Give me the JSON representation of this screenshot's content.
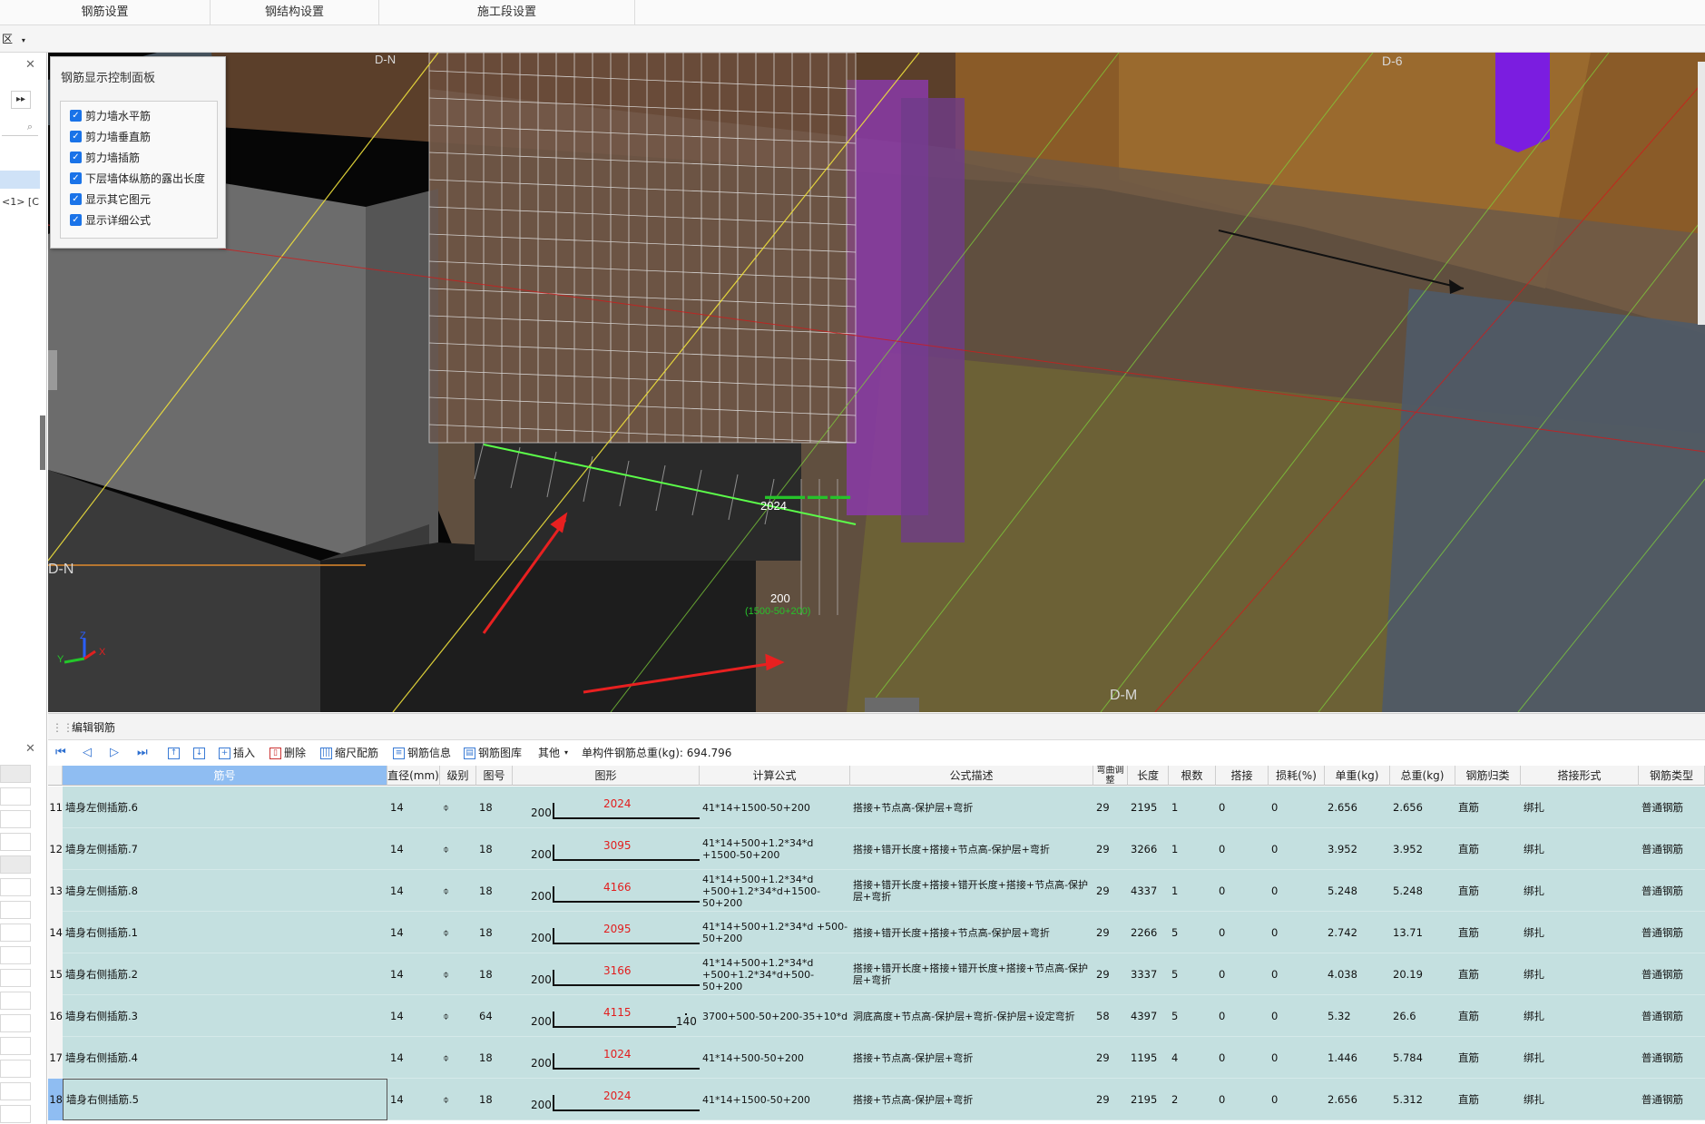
{
  "top_tabs": [
    "钢筋设置",
    "钢结构设置",
    "施工段设置"
  ],
  "region_select": "区",
  "left_panel": {
    "text_1": "<1> [C"
  },
  "control_panel": {
    "title": "钢筋显示控制面板",
    "items": [
      {
        "label": "剪力墙水平筋",
        "checked": true
      },
      {
        "label": "剪力墙垂直筋",
        "checked": true
      },
      {
        "label": "剪力墙插筋",
        "checked": true
      },
      {
        "label": "下层墙体纵筋的露出长度",
        "checked": true
      },
      {
        "label": "显示其它图元",
        "checked": true
      },
      {
        "label": "显示详细公式",
        "checked": true
      }
    ]
  },
  "viewport": {
    "axis_labels": [
      "D-N",
      "D-M",
      "D-6",
      "D-N"
    ],
    "dim_labels": [
      "2024",
      "200"
    ],
    "dim_sub_labels": [
      "(1500-50+200)"
    ],
    "axis_triad": {
      "x": "X",
      "y": "Y",
      "z": "Z"
    },
    "arrow_color": "#e82020"
  },
  "edit_panel": {
    "title": "编辑钢筋",
    "toolbar": {
      "insert": "插入",
      "delete": "删除",
      "scale_rebar": "缩尺配筋",
      "rebar_info": "钢筋信息",
      "rebar_library": "钢筋图库",
      "other": "其他",
      "total_weight": "单构件钢筋总重(kg): 694.796"
    },
    "columns": [
      "筋号",
      "直径(mm)",
      "级别",
      "图号",
      "图形",
      "计算公式",
      "公式描述",
      "弯曲调整",
      "长度",
      "根数",
      "搭接",
      "损耗(%)",
      "单重(kg)",
      "总重(kg)",
      "钢筋归类",
      "搭接形式",
      "钢筋类型"
    ],
    "rows": [
      {
        "num": "11",
        "name": "墙身左侧插筋.6",
        "dia": "14",
        "grade": "⌽",
        "fig": "18",
        "shape_left": "200",
        "shape_value": "2024",
        "shape_right": "",
        "formula": "41*14+1500-50+200",
        "desc": "搭接+节点高-保护层+弯折",
        "bend": "29",
        "length": "2195",
        "count": "1",
        "lap": "0",
        "loss": "0",
        "unit_w": "2.656",
        "total_w": "2.656",
        "category": "直筋",
        "lap_type": "绑扎",
        "type": "普通钢筋"
      },
      {
        "num": "12",
        "name": "墙身左侧插筋.7",
        "dia": "14",
        "grade": "⌽",
        "fig": "18",
        "shape_left": "200",
        "shape_value": "3095",
        "shape_right": "",
        "formula": "41*14+500+1.2*34*d +1500-50+200",
        "desc": "搭接+错开长度+搭接+节点高-保护层+弯折",
        "bend": "29",
        "length": "3266",
        "count": "1",
        "lap": "0",
        "loss": "0",
        "unit_w": "3.952",
        "total_w": "3.952",
        "category": "直筋",
        "lap_type": "绑扎",
        "type": "普通钢筋"
      },
      {
        "num": "13",
        "name": "墙身左侧插筋.8",
        "dia": "14",
        "grade": "⌽",
        "fig": "18",
        "shape_left": "200",
        "shape_value": "4166",
        "shape_right": "",
        "formula": "41*14+500+1.2*34*d +500+1.2*34*d+1500-50+200",
        "desc": "搭接+错开长度+搭接+错开长度+搭接+节点高-保护层+弯折",
        "bend": "29",
        "length": "4337",
        "count": "1",
        "lap": "0",
        "loss": "0",
        "unit_w": "5.248",
        "total_w": "5.248",
        "category": "直筋",
        "lap_type": "绑扎",
        "type": "普通钢筋"
      },
      {
        "num": "14",
        "name": "墙身右侧插筋.1",
        "dia": "14",
        "grade": "⌽",
        "fig": "18",
        "shape_left": "200",
        "shape_value": "2095",
        "shape_right": "",
        "formula": "41*14+500+1.2*34*d +500-50+200",
        "desc": "搭接+错开长度+搭接+节点高-保护层+弯折",
        "bend": "29",
        "length": "2266",
        "count": "5",
        "lap": "0",
        "loss": "0",
        "unit_w": "2.742",
        "total_w": "13.71",
        "category": "直筋",
        "lap_type": "绑扎",
        "type": "普通钢筋"
      },
      {
        "num": "15",
        "name": "墙身右侧插筋.2",
        "dia": "14",
        "grade": "⌽",
        "fig": "18",
        "shape_left": "200",
        "shape_value": "3166",
        "shape_right": "",
        "formula": "41*14+500+1.2*34*d +500+1.2*34*d+500-50+200",
        "desc": "搭接+错开长度+搭接+错开长度+搭接+节点高-保护层+弯折",
        "bend": "29",
        "length": "3337",
        "count": "5",
        "lap": "0",
        "loss": "0",
        "unit_w": "4.038",
        "total_w": "20.19",
        "category": "直筋",
        "lap_type": "绑扎",
        "type": "普通钢筋"
      },
      {
        "num": "16",
        "name": "墙身右侧插筋.3",
        "dia": "14",
        "grade": "⌽",
        "fig": "64",
        "shape_left": "200",
        "shape_value": "4115",
        "shape_right": "140",
        "formula": "3700+500-50+200-35+10*d",
        "desc": "洞底高度+节点高-保护层+弯折-保护层+设定弯折",
        "bend": "58",
        "length": "4397",
        "count": "5",
        "lap": "0",
        "loss": "0",
        "unit_w": "5.32",
        "total_w": "26.6",
        "category": "直筋",
        "lap_type": "绑扎",
        "type": "普通钢筋"
      },
      {
        "num": "17",
        "name": "墙身右侧插筋.4",
        "dia": "14",
        "grade": "⌽",
        "fig": "18",
        "shape_left": "200",
        "shape_value": "1024",
        "shape_right": "",
        "formula": "41*14+500-50+200",
        "desc": "搭接+节点高-保护层+弯折",
        "bend": "29",
        "length": "1195",
        "count": "4",
        "lap": "0",
        "loss": "0",
        "unit_w": "1.446",
        "total_w": "5.784",
        "category": "直筋",
        "lap_type": "绑扎",
        "type": "普通钢筋"
      },
      {
        "num": "18",
        "name": "墙身右侧插筋.5",
        "dia": "14",
        "grade": "⌽",
        "fig": "18",
        "shape_left": "200",
        "shape_value": "2024",
        "shape_right": "",
        "formula": "41*14+1500-50+200",
        "desc": "搭接+节点高-保护层+弯折",
        "bend": "29",
        "length": "2195",
        "count": "2",
        "lap": "0",
        "loss": "0",
        "unit_w": "2.656",
        "total_w": "5.312",
        "category": "直筋",
        "lap_type": "绑扎",
        "type": "普通钢筋"
      }
    ]
  }
}
